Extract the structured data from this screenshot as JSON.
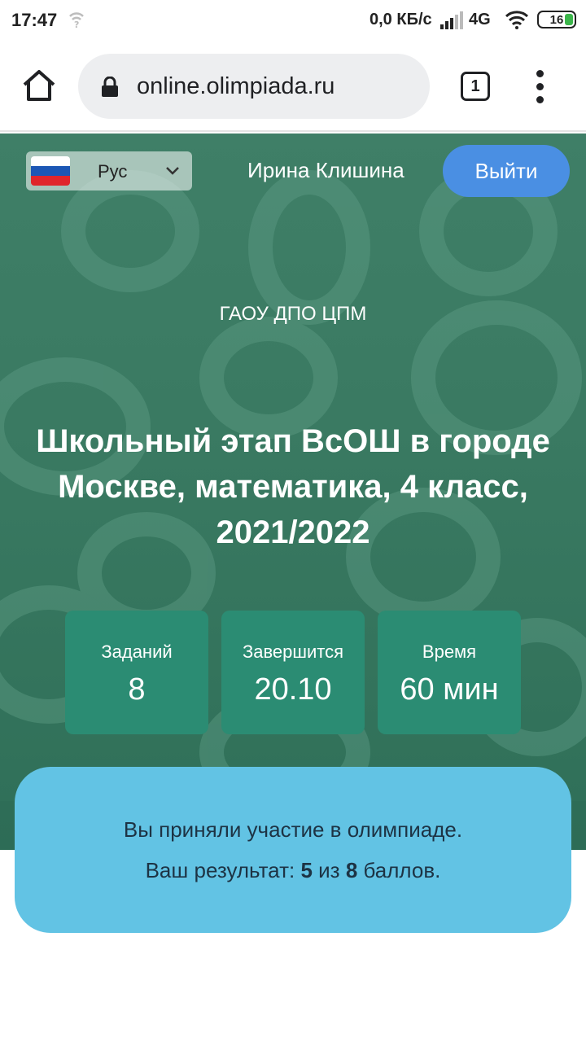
{
  "status_bar": {
    "time": "17:47",
    "network_speed": "0,0 КБ/с",
    "network_type": "4G",
    "battery": "16",
    "battery_color": "#3bb54a"
  },
  "browser": {
    "url": "online.olimpiada.ru",
    "tab_count": "1",
    "icons": [
      "home-icon",
      "lock-icon",
      "tabs-icon",
      "more-vert-icon"
    ]
  },
  "header": {
    "language": "Рус",
    "user_name": "Ирина Клишина",
    "logout_label": "Выйти",
    "logout_color": "#4a8fe3"
  },
  "event": {
    "organization": "ГАОУ ДПО ЦПМ",
    "title": "Школьный этап ВсОШ в городе Москве, математика, 4 класс, 2021/2022"
  },
  "stats": [
    {
      "label": "Заданий",
      "value": "8"
    },
    {
      "label": "Завершится",
      "value": "20.10"
    },
    {
      "label": "Время",
      "value": "60 мин"
    }
  ],
  "result": {
    "participation": "Вы приняли участие в олимпиаде.",
    "prefix": "Ваш результат: ",
    "score": "5",
    "of": " из ",
    "max": "8",
    "suffix": " баллов.",
    "card_color": "#62c3e4"
  }
}
